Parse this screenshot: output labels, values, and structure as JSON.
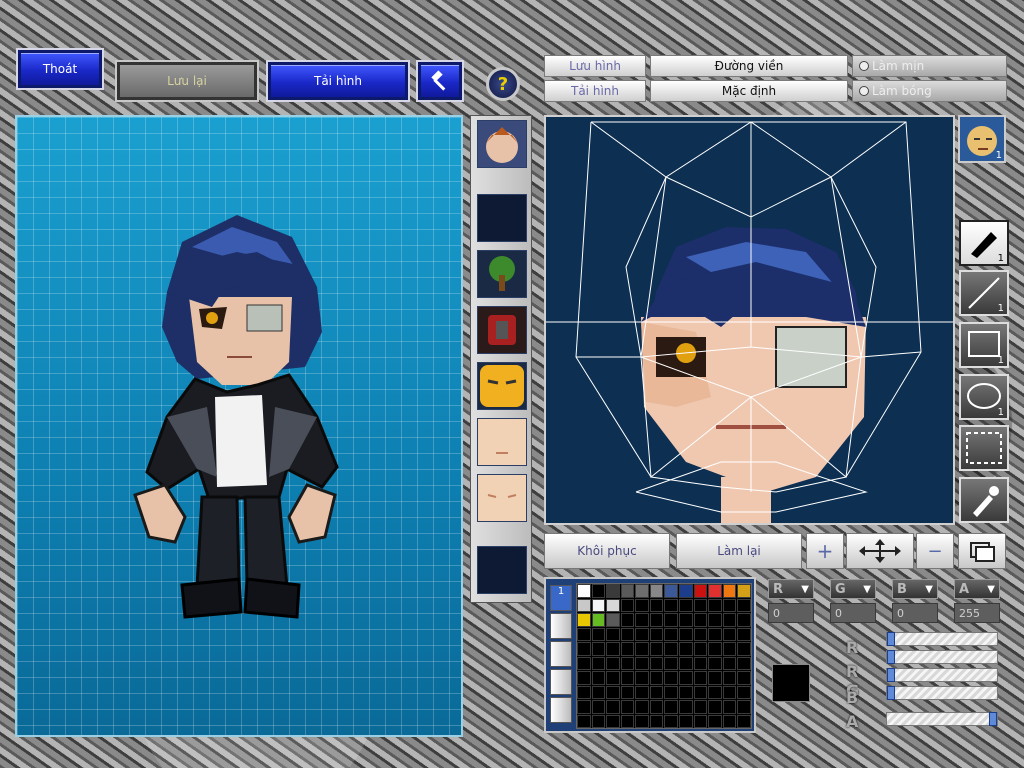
{
  "toolbar": {
    "exit_label": "Thoát",
    "save_label": "Lưu lại",
    "reload_label": "Tải hình",
    "build_icon": "hammer-icon",
    "help_icon": "question-icon"
  },
  "editor": {
    "save_image_tab": "Lưu hình",
    "reload_image_tab": "Tải hình",
    "outline_button": "Đường viền",
    "default_button": "Mặc định",
    "smooth_option": "Làm mịn",
    "shade_option": "Làm bóng"
  },
  "tools": [
    {
      "name": "pen-tool",
      "badge": "1"
    },
    {
      "name": "line-tool",
      "badge": "1"
    },
    {
      "name": "rectangle-tool",
      "badge": "1"
    },
    {
      "name": "ellipse-tool",
      "badge": "1"
    },
    {
      "name": "selection-tool",
      "badge": ""
    },
    {
      "name": "eyedropper-tool",
      "badge": ""
    }
  ],
  "head_thumbnail_badge": "1",
  "actions": {
    "restore_label": "Khôi phục",
    "redo_label": "Làm lại"
  },
  "layer": {
    "active_label": "1"
  },
  "palette": {
    "top_row": [
      "#ffffff",
      "#000000",
      "#3a3a3a",
      "#5a5a5a",
      "#6e6e6e",
      "#888888",
      "#3b5998",
      "#1c3c8c",
      "#cc1111",
      "#e03030",
      "#ee7711",
      "#d4a017"
    ],
    "second_row": [
      "#c8c8c8",
      "#f5f5f5",
      "#d8d8d8"
    ],
    "third_row": [
      "#e8c800",
      "#66bb22",
      "#5a5a5a"
    ]
  },
  "color": {
    "r_label": "R",
    "g_label": "G",
    "b_label": "B",
    "a_label": "A",
    "r": "0",
    "g": "0",
    "b": "0",
    "a": "255",
    "current": "#000000",
    "sliders": {
      "r": 0,
      "g": 0,
      "b": 0,
      "a": 1.0
    }
  },
  "colors": {
    "canvas_bg": "#0d87b5",
    "editor_bg": "#0c2f52",
    "button_blue": "#2434d8"
  }
}
